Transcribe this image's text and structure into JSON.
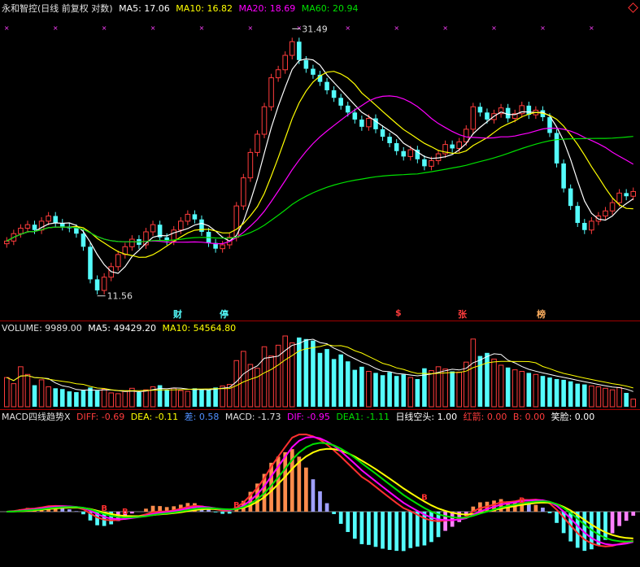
{
  "price_header": {
    "title": "永和智控(日线 前复权 对数)",
    "ma5": "MA5: 17.06",
    "ma10": "MA10: 16.82",
    "ma20": "MA20: 18.69",
    "ma60": "MA60: 20.94"
  },
  "volume_header": {
    "volume": "VOLUME: 9989.00",
    "ma5": "MA5: 49429.20",
    "ma10": "MA10: 54564.80"
  },
  "macd_header": {
    "name": "MACD四线趋势X",
    "diff": "DIFF: -0.69",
    "dea": "DEA: -0.11",
    "cha": "差: 0.58",
    "macd": "MACD: -1.73",
    "dif": "DIF: -0.95",
    "dea1": "DEA1: -1.11",
    "kongtou": "日线空头: 1.00",
    "hongjian": "红箭: 0.00",
    "b": "B: 0.00",
    "xiaolian": "笑脸: 0.00"
  },
  "annotations": {
    "high_label": "31.49",
    "low_label": "11.56",
    "cai": "财",
    "ting": "停",
    "dollar": "$",
    "zhang": "张",
    "bang": "榜",
    "b_marker": "B"
  },
  "colors": {
    "up": "#ff3c3c",
    "down": "#54fcfc",
    "ma5": "#ffffff",
    "ma10": "#ffff00",
    "ma20": "#ff00ff",
    "ma60": "#00e000",
    "axis_red": "#a00000"
  },
  "chart_data": [
    {
      "type": "candlestick",
      "title": "永和智控(日线 前复权 对数)",
      "y_scale": "log",
      "ylim": [
        11,
        33
      ],
      "annotated_high": 31.49,
      "annotated_low": 11.56,
      "series": [
        {
          "name": "MA5",
          "last": 17.06
        },
        {
          "name": "MA10",
          "last": 16.82
        },
        {
          "name": "MA20",
          "last": 18.69
        },
        {
          "name": "MA60",
          "last": 20.94
        }
      ],
      "close_approx": [
        14.2,
        14.6,
        14.9,
        15.1,
        14.8,
        15.3,
        15.6,
        15.2,
        15.0,
        14.9,
        14.6,
        13.9,
        12.3,
        11.8,
        12.4,
        12.9,
        13.5,
        13.9,
        14.3,
        14.0,
        14.7,
        15.1,
        14.4,
        14.2,
        14.8,
        15.3,
        15.7,
        15.4,
        14.7,
        14.1,
        13.8,
        14.0,
        14.4,
        16.2,
        18.0,
        19.8,
        21.2,
        23.5,
        26.2,
        27.0,
        28.5,
        30.0,
        28.0,
        27.1,
        26.5,
        25.8,
        25.0,
        24.3,
        23.6,
        23.0,
        22.4,
        21.8,
        22.5,
        21.6,
        21.0,
        20.5,
        19.9,
        19.5,
        20.0,
        19.3,
        18.8,
        19.2,
        19.7,
        20.4,
        20.1,
        20.6,
        21.6,
        23.5,
        23.0,
        22.4,
        22.9,
        23.4,
        22.5,
        22.9,
        23.6,
        22.8,
        23.2,
        22.6,
        21.3,
        19.0,
        17.3,
        16.2,
        15.2,
        14.8,
        15.3,
        15.6,
        15.9,
        16.4,
        17.0,
        16.8,
        17.1
      ]
    },
    {
      "type": "bar",
      "title": "VOLUME",
      "series": [
        {
          "name": "VOLUME",
          "last": 9989.0
        },
        {
          "name": "MA5",
          "last": 49429.2
        },
        {
          "name": "MA10",
          "last": 54564.8
        }
      ],
      "values_approx": [
        38000,
        30000,
        52000,
        42000,
        28000,
        35000,
        26000,
        24000,
        23000,
        20000,
        19000,
        22000,
        25000,
        21000,
        23000,
        18000,
        17000,
        20000,
        24000,
        19000,
        22000,
        26000,
        28000,
        22000,
        24000,
        21000,
        20000,
        24000,
        23000,
        22000,
        25000,
        27000,
        29000,
        60000,
        72000,
        55000,
        50000,
        78000,
        66000,
        80000,
        92000,
        83000,
        90000,
        88000,
        86000,
        70000,
        75000,
        62000,
        68000,
        59000,
        48000,
        52000,
        46000,
        44000,
        41000,
        45000,
        40000,
        42000,
        38000,
        36000,
        50000,
        47000,
        52000,
        49000,
        46000,
        45000,
        58000,
        88000,
        66000,
        70000,
        62000,
        54000,
        51000,
        48000,
        46000,
        44000,
        42000,
        40000,
        38000,
        36000,
        35000,
        33000,
        30000,
        29000,
        27000,
        26000,
        24000,
        22000,
        25000,
        18000,
        9989
      ]
    },
    {
      "type": "line",
      "title": "MACD四线趋势X",
      "series": [
        {
          "name": "DIFF",
          "last": -0.69
        },
        {
          "name": "DEA",
          "last": -0.11
        },
        {
          "name": "差",
          "last": 0.58
        },
        {
          "name": "MACD",
          "last": -1.73
        },
        {
          "name": "DIF",
          "last": -0.95
        },
        {
          "name": "DEA1",
          "last": -1.11
        }
      ]
    }
  ]
}
